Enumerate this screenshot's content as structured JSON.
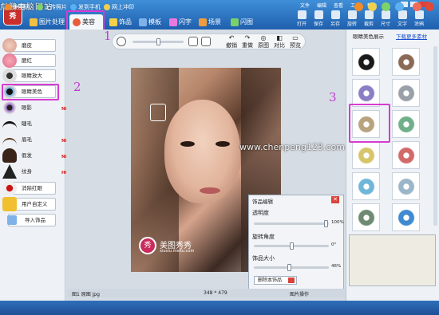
{
  "site_watermark": "彪鹏电脑网站",
  "site_url": "www.chenpeng123.com",
  "app": {
    "logo": "秀"
  },
  "main_tabs": [
    {
      "label": "图片处理",
      "active": false
    },
    {
      "label": "美容",
      "active": true
    },
    {
      "label": "饰品",
      "active": false
    },
    {
      "label": "模板",
      "active": false
    },
    {
      "label": "闪字",
      "active": false
    },
    {
      "label": "场景",
      "active": false
    },
    {
      "label": "闪图",
      "active": false
    }
  ],
  "menu": [
    "文件",
    "编辑",
    "查看",
    "工具",
    "帮助"
  ],
  "toolbar": [
    "打开",
    "保存",
    "另存",
    "旋转",
    "裁剪",
    "尺寸",
    "文字",
    "涂鸦"
  ],
  "left_items": [
    {
      "label": "磨皮",
      "badge": ""
    },
    {
      "label": "腮红",
      "badge": ""
    },
    {
      "label": "眼睛放大",
      "badge": ""
    },
    {
      "label": "眼睛美色",
      "badge": "NEW"
    },
    {
      "label": "眼影",
      "badge": "NEW"
    },
    {
      "label": "睫毛",
      "badge": ""
    },
    {
      "label": "眉毛",
      "badge": "NEW"
    },
    {
      "label": "假发",
      "badge": "NEW"
    },
    {
      "label": "纹身",
      "badge": "HOT"
    },
    {
      "label": "消除红眼",
      "badge": ""
    },
    {
      "label": "用户自定义",
      "badge": ""
    },
    {
      "label": "导入饰品",
      "badge": ""
    }
  ],
  "canvas_toolbar": [
    "撤销",
    "重做",
    "原图",
    "对比",
    "预览"
  ],
  "photo_brand": {
    "name": "美图秀秀",
    "url": "xiuxiu.meitu.com"
  },
  "ornament_panel": {
    "title": "饰品编辑",
    "opacity_label": "透明度",
    "opacity_value": "100%",
    "rotate_label": "旋转角度",
    "rotate_value": "0°",
    "size_label": "饰品大小",
    "size_value": "46%",
    "delete_button": "删除本饰品"
  },
  "right_panel": {
    "title": "眼睛美色展示",
    "more_link": "下载更多素材"
  },
  "lens_colors": [
    "#1a1a1a",
    "#8a6a55",
    "#8a7fc4",
    "#9aa0a8",
    "#b7a37d",
    "#6fb08a",
    "#d7c56a",
    "#d36a6a",
    "#6fb6d8",
    "#9bb6c9",
    "#6f8a72",
    "#3f8ad0"
  ],
  "status": {
    "left": "图1 原图 jpg",
    "size": "348 * 479",
    "right": "图片操作"
  },
  "bottom_links": [
    "美图网",
    "上传照片",
    "发到手机",
    "网上冲印"
  ],
  "annotations": [
    "1",
    "2",
    "3"
  ]
}
